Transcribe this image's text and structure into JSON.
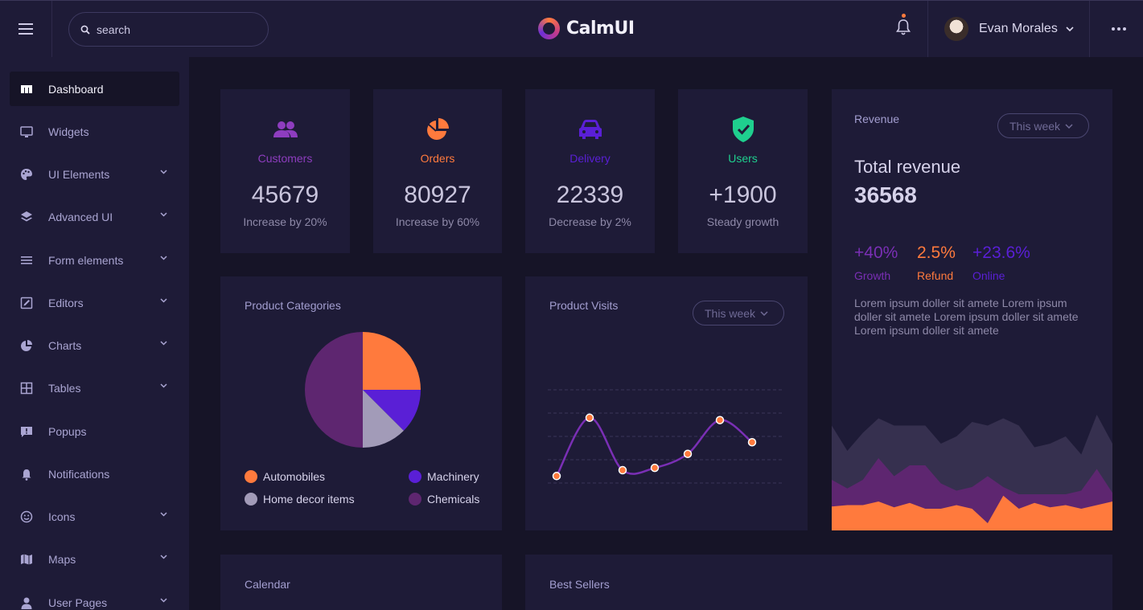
{
  "header": {
    "search_placeholder": "search",
    "logo": "CalmUI",
    "user_name": "Evan Morales"
  },
  "sidebar": {
    "items": [
      {
        "label": "Dashboard",
        "icon": "dashboard-icon",
        "active": true,
        "expandable": false
      },
      {
        "label": "Widgets",
        "icon": "monitor-icon",
        "expandable": false
      },
      {
        "label": "UI Elements",
        "icon": "palette-icon",
        "expandable": true
      },
      {
        "label": "Advanced UI",
        "icon": "layers-icon",
        "expandable": true
      },
      {
        "label": "Form elements",
        "icon": "list-icon",
        "expandable": true
      },
      {
        "label": "Editors",
        "icon": "edit-icon",
        "expandable": true
      },
      {
        "label": "Charts",
        "icon": "pie-chart-icon",
        "expandable": true
      },
      {
        "label": "Tables",
        "icon": "table-icon",
        "expandable": true
      },
      {
        "label": "Popups",
        "icon": "popup-icon",
        "expandable": false
      },
      {
        "label": "Notifications",
        "icon": "bell-icon",
        "expandable": false
      },
      {
        "label": "Icons",
        "icon": "smile-icon",
        "expandable": true
      },
      {
        "label": "Maps",
        "icon": "map-icon",
        "expandable": true
      },
      {
        "label": "User Pages",
        "icon": "user-icon",
        "expandable": true
      }
    ]
  },
  "stats": [
    {
      "label": "Customers",
      "value": "45679",
      "sub": "Increase by 20%",
      "color": "#8e3dbf",
      "icon": "users-icon"
    },
    {
      "label": "Orders",
      "value": "80927",
      "sub": "Increase by 60%",
      "color": "#ff7a3d",
      "icon": "pie-icon"
    },
    {
      "label": "Delivery",
      "value": "22339",
      "sub": "Decrease by 2%",
      "color": "#5a1fd6",
      "icon": "car-icon"
    },
    {
      "label": "Users",
      "value": "+1900",
      "sub": "Steady growth",
      "color": "#1fcf8e",
      "icon": "shield-check-icon"
    }
  ],
  "product_categories": {
    "title": "Product Categories",
    "legend": [
      "Automobiles",
      "Machinery",
      "Home decor items",
      "Chemicals"
    ]
  },
  "product_visits": {
    "title": "Product Visits",
    "range": "This week"
  },
  "revenue": {
    "label": "Revenue",
    "range": "This week",
    "title": "Total revenue",
    "value": "36568",
    "metrics": [
      {
        "value": "+40%",
        "label": "Growth",
        "color": "#7a2fb5"
      },
      {
        "value": "2.5%",
        "label": "Refund",
        "color": "#ff7a3d"
      },
      {
        "value": "+23.6%",
        "label": "Online",
        "color": "#5a1fd6"
      }
    ],
    "description": "Lorem ipsum doller sit amete Lorem ipsum doller sit amete Lorem ipsum doller sit amete Lorem ipsum doller sit amete"
  },
  "bottom": {
    "calendar_title": "Calendar",
    "best_sellers_title": "Best Sellers"
  },
  "chart_data": [
    {
      "type": "pie",
      "categories": [
        "Automobiles",
        "Machinery",
        "Home decor items",
        "Chemicals"
      ],
      "values": [
        25,
        12.5,
        12.5,
        50
      ],
      "colors": [
        "#ff7a3d",
        "#5a1fd6",
        "#a29bb8",
        "#5e2670"
      ]
    },
    {
      "type": "line",
      "x": [
        1,
        2,
        3,
        4,
        5,
        6,
        7
      ],
      "values": [
        0.3,
        2.8,
        0.55,
        0.65,
        1.25,
        2.7,
        1.75
      ],
      "ylim": [
        0,
        4
      ],
      "grid": true,
      "colors": [
        "#7a2fb5",
        "#ff7a3d"
      ]
    },
    {
      "type": "area",
      "x": [
        0,
        1,
        2,
        3,
        4,
        5,
        6,
        7,
        8,
        9,
        10,
        11,
        12,
        13,
        14,
        15,
        16,
        17,
        18
      ],
      "series": [
        {
          "values": [
            1.45,
            1.1,
            1.35,
            1.55,
            1.45,
            1.45,
            1.45,
            1.2,
            1.3,
            1.5,
            1.45,
            1.55,
            1.45,
            1.15,
            1.2,
            1.3,
            1.05,
            1.6,
            1.2
          ],
          "color": "#36304f"
        },
        {
          "values": [
            0.7,
            0.58,
            0.7,
            1.0,
            0.75,
            0.9,
            0.9,
            0.65,
            0.55,
            0.6,
            0.75,
            0.6,
            0.5,
            0.5,
            0.5,
            0.5,
            0.55,
            0.85,
            0.52
          ],
          "color": "#5e2670"
        },
        {
          "values": [
            0.33,
            0.35,
            0.35,
            0.4,
            0.32,
            0.38,
            0.3,
            0.3,
            0.35,
            0.3,
            0.1,
            0.48,
            0.3,
            0.38,
            0.32,
            0.35,
            0.3,
            0.35,
            0.4
          ],
          "color": "#ff7a3d"
        }
      ],
      "ylim": [
        0,
        2
      ]
    }
  ]
}
